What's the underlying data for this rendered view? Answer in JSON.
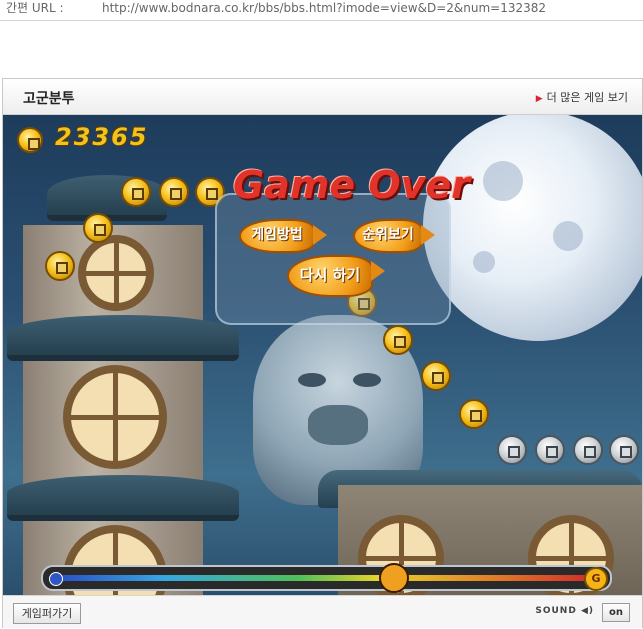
{
  "url_bar": {
    "label": "간편 URL :",
    "value": "http://www.bodnara.co.kr/bbs/bbs.html?imode=view&D=2&num=132382"
  },
  "panel": {
    "title": "고군분투",
    "more_link": "더 많은 게임 보기"
  },
  "game": {
    "score": "23365",
    "game_over_text": "Game Over",
    "buttons": {
      "how_to_play": "게임방법",
      "ranking": "순위보기",
      "play_again": "다시 하기"
    },
    "progress_goal_letter": "G",
    "accent_gold": "#f2c21e",
    "accent_red": "#e0332a"
  },
  "footer": {
    "embed_button": "게임퍼가기",
    "sound_label": "SOUND",
    "sound_toggle": "on"
  }
}
